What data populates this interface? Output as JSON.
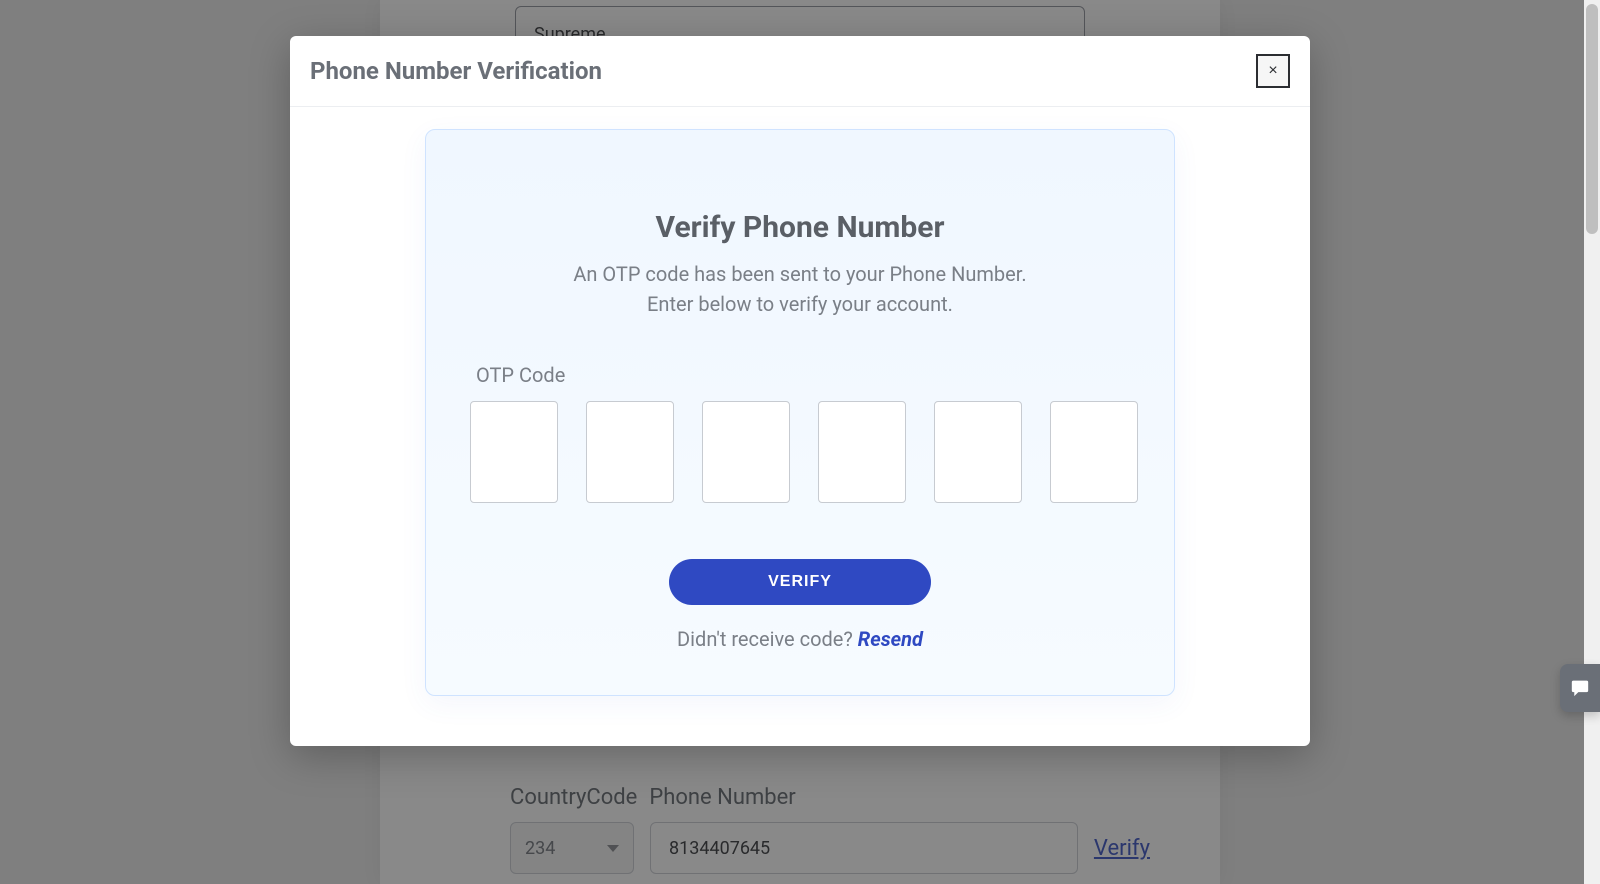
{
  "background": {
    "top_field_value": "Supreme",
    "labels": {
      "country_code": "CountryCode",
      "phone_number": "Phone Number"
    },
    "country_code_value": "234",
    "phone_value": "8134407645",
    "verify_link": "Verify"
  },
  "modal": {
    "title": "Phone Number Verification",
    "close_symbol": "×",
    "panel": {
      "heading": "Verify Phone Number",
      "description_line1": "An OTP code has been sent to your Phone Number.",
      "description_line2": "Enter below to verify your account.",
      "otp_label": "OTP Code",
      "otp_values": [
        "",
        "",
        "",
        "",
        "",
        ""
      ],
      "verify_button": "VERIFY",
      "resend_prompt": "Didn't receive code? ",
      "resend_action": "Resend"
    }
  }
}
